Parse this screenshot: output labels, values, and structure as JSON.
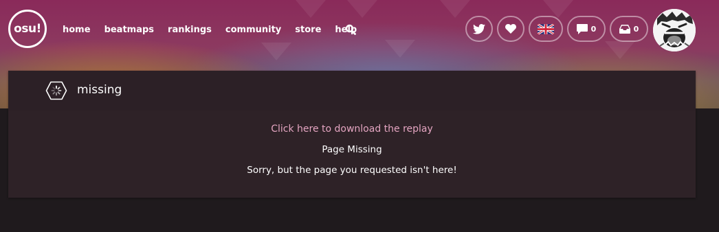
{
  "nav": {
    "logo_text": "osu!",
    "items": [
      "home",
      "beatmaps",
      "rankings",
      "community",
      "store",
      "help"
    ],
    "chat_count": "0",
    "notification_count": "0"
  },
  "icons": {
    "search": "search-icon",
    "twitter": "twitter-icon",
    "support": "heart-icon",
    "language": "uk-flag-icon",
    "chat": "chat-bubble-icon",
    "notifications": "inbox-icon",
    "page": "spinner-hexagon-icon"
  },
  "page": {
    "title": "missing",
    "download_link": "Click here to download the replay",
    "heading": "Page Missing",
    "message": "Sorry, but the page you requested isn't here!"
  },
  "colors": {
    "accent_link": "#e4a5c1",
    "panel_bg": "#2e2227",
    "page_bg": "#1f1a1d"
  }
}
